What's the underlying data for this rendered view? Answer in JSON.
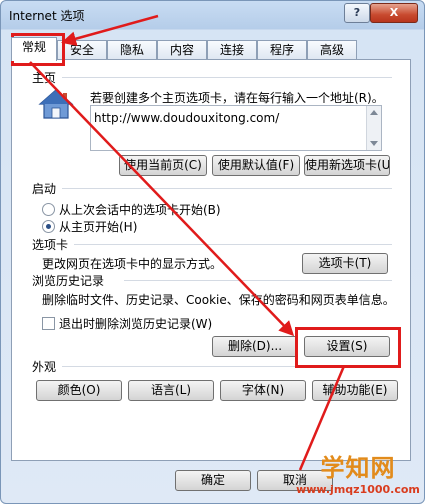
{
  "window": {
    "title": "Internet 选项",
    "help_label": "?",
    "close_label": "X"
  },
  "tabs": [
    "常规",
    "安全",
    "隐私",
    "内容",
    "连接",
    "程序",
    "高级"
  ],
  "home": {
    "heading": "主页",
    "instruction": "若要创建多个主页选项卡，请在每行输入一个地址(R)。",
    "url": "http://www.doudouxitong.com/",
    "btn_use_current": "使用当前页(C)",
    "btn_use_default": "使用默认值(F)",
    "btn_use_new_tab": "使用新选项卡(U)"
  },
  "startup": {
    "heading": "启动",
    "option_last_session": "从上次会话中的选项卡开始(B)",
    "option_home": "从主页开始(H)"
  },
  "tabs_section": {
    "heading": "选项卡",
    "desc": "更改网页在选项卡中的显示方式。",
    "button": "选项卡(T)"
  },
  "history": {
    "heading": "浏览历史记录",
    "desc": "删除临时文件、历史记录、Cookie、保存的密码和网页表单信息。",
    "checkbox_label": "退出时删除浏览历史记录(W)",
    "delete_button": "删除(D)...",
    "settings_button": "设置(S)"
  },
  "appearance": {
    "heading": "外观",
    "colors": "颜色(O)",
    "languages": "语言(L)",
    "fonts": "字体(N)",
    "accessibility": "辅助功能(E)"
  },
  "footer": {
    "ok": "确定",
    "cancel": "取消"
  },
  "watermark": {
    "main": "学知网",
    "url": "www.jmqz1000.com"
  },
  "colors": {
    "annotation_red": "#e01b1b"
  }
}
